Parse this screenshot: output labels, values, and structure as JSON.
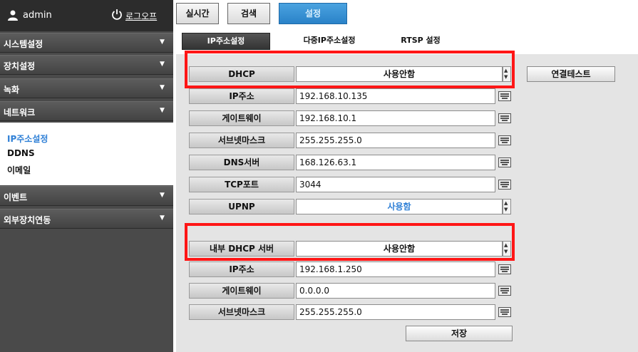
{
  "user": {
    "name": "admin",
    "logoff_label": "로그오프"
  },
  "top_tabs": [
    "실시간",
    "검색",
    "설정"
  ],
  "sidebar": {
    "menu": [
      "시스템설정",
      "장치설정",
      "녹화",
      "네트워크",
      "이벤트",
      "외부장치연동"
    ],
    "network_sub": [
      "IP주소설정",
      "DDNS",
      "이메일"
    ]
  },
  "sub_tabs": [
    "IP주소설정",
    "다중IP주소설정",
    "RTSP 설정"
  ],
  "network": {
    "dhcp": {
      "label": "DHCP",
      "value": "사용안함"
    },
    "ip": {
      "label": "IP주소",
      "value": "192.168.10.135"
    },
    "gateway": {
      "label": "게이트웨이",
      "value": "192.168.10.1"
    },
    "subnet": {
      "label": "서브넷마스크",
      "value": "255.255.255.0"
    },
    "dns": {
      "label": "DNS서버",
      "value": "168.126.63.1"
    },
    "tcp_port": {
      "label": "TCP포트",
      "value": "3044"
    },
    "upnp": {
      "label": "UPNP",
      "value": "사용함"
    }
  },
  "dhcp_server": {
    "mode": {
      "label": "내부 DHCP 서버",
      "value": "사용안함"
    },
    "ip": {
      "label": "IP주소",
      "value": "192.168.1.250"
    },
    "gateway": {
      "label": "게이트웨이",
      "value": "0.0.0.0"
    },
    "subnet": {
      "label": "서브넷마스크",
      "value": "255.255.255.0"
    }
  },
  "buttons": {
    "connect_test": "연결테스트",
    "save": "저장"
  },
  "colors": {
    "highlight": "#ff1616",
    "active_tab": "#2a82c8",
    "active_link": "#2e7fd6"
  }
}
